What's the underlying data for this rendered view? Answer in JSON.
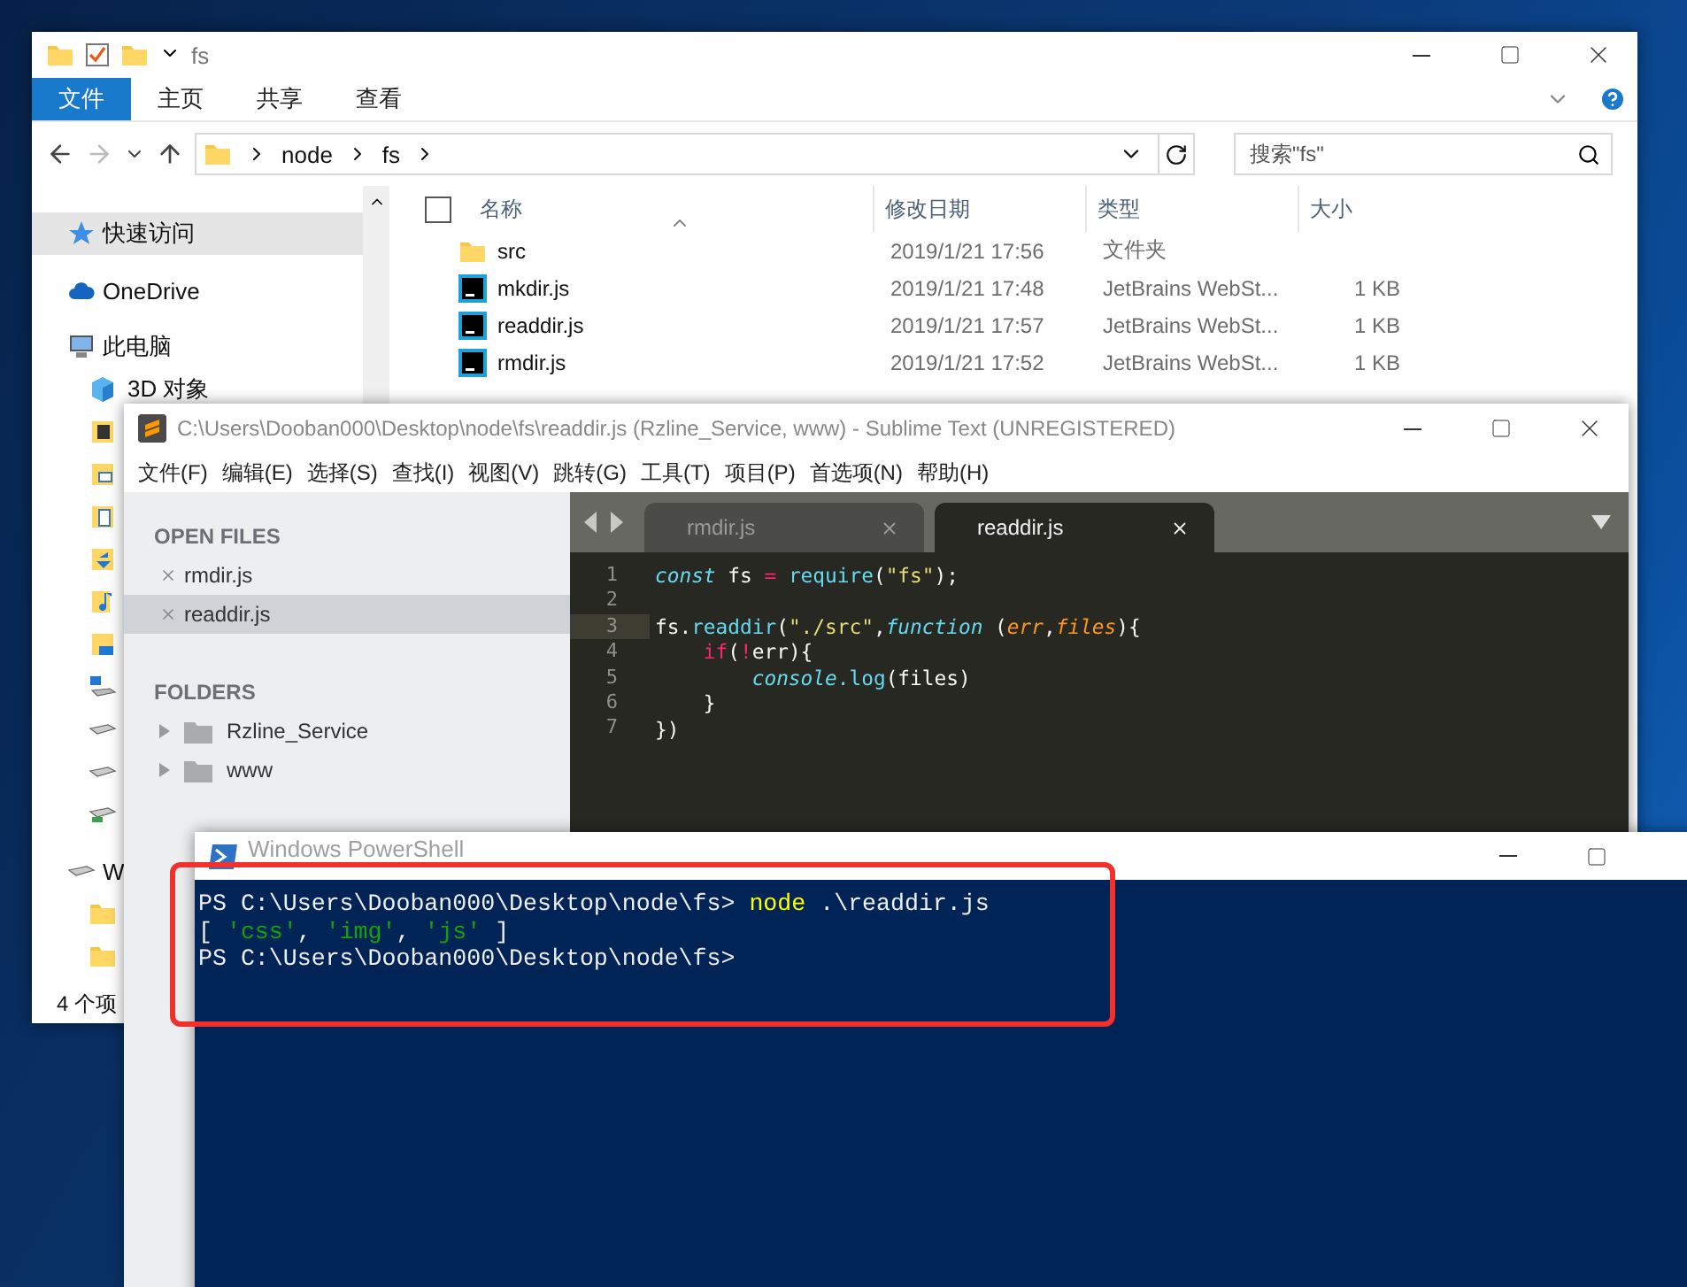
{
  "explorer": {
    "title": "fs",
    "ribbon_tabs": [
      {
        "label": "文件",
        "selected": true
      },
      {
        "label": "主页",
        "selected": false
      },
      {
        "label": "共享",
        "selected": false
      },
      {
        "label": "查看",
        "selected": false
      }
    ],
    "select_all": {
      "checked": false
    },
    "nav": {
      "back": {
        "disabled": false
      },
      "forward": {
        "disabled": true
      }
    },
    "breadcrumbs": [
      "node",
      "fs"
    ],
    "search": {
      "placeholder": "搜索\"fs\""
    },
    "sidebar": [
      {
        "kind": "star",
        "label": "快速访问",
        "selected": true
      },
      {
        "kind": "cloud",
        "label": "OneDrive",
        "selected": false
      },
      {
        "kind": "pc",
        "label": "此电脑",
        "selected": false,
        "children": [
          {
            "kind": "cube",
            "label": "3D 对象",
            "selected": false
          },
          {
            "kind": "film",
            "selected": false
          },
          {
            "kind": "image",
            "selected": false
          },
          {
            "kind": "document",
            "selected": false
          },
          {
            "kind": "download",
            "selected": false
          },
          {
            "kind": "music",
            "selected": false
          },
          {
            "kind": "desktop",
            "selected": false
          },
          {
            "kind": "system-drive",
            "selected": false
          },
          {
            "kind": "drive",
            "selected": false
          },
          {
            "kind": "drive",
            "selected": false
          },
          {
            "kind": "network-drive",
            "selected": false
          }
        ]
      },
      {
        "kind": "drive",
        "label": "W",
        "selected": false,
        "children": [
          {
            "kind": "folder",
            "selected": false
          },
          {
            "kind": "folder",
            "selected": false
          }
        ]
      }
    ],
    "columns": [
      "名称",
      "修改日期",
      "类型",
      "大小"
    ],
    "rows": [
      {
        "kind": "folder",
        "name": "src",
        "modified": "2019/1/21 17:56",
        "type": "文件夹"
      },
      {
        "kind": "script",
        "name": "mkdir.js",
        "modified": "2019/1/21 17:48",
        "type": "JetBrains WebSt...",
        "size": "1 KB"
      },
      {
        "kind": "script",
        "name": "readdir.js",
        "modified": "2019/1/21 17:57",
        "type": "JetBrains WebSt...",
        "size": "1 KB"
      },
      {
        "kind": "script",
        "name": "rmdir.js",
        "modified": "2019/1/21 17:52",
        "type": "JetBrains WebSt...",
        "size": "1 KB"
      }
    ],
    "status": "4 个项"
  },
  "sublime": {
    "title": "C:\\Users\\Dooban000\\Desktop\\node\\fs\\readdir.js (Rzline_Service, www) - Sublime Text (UNREGISTERED)",
    "menu": [
      "文件(F)",
      "编辑(E)",
      "选择(S)",
      "查找(I)",
      "视图(V)",
      "跳转(G)",
      "工具(T)",
      "项目(P)",
      "首选项(N)",
      "帮助(H)"
    ],
    "open_files": {
      "heading": "OPEN FILES",
      "items": [
        {
          "name": "rmdir.js",
          "selected": false
        },
        {
          "name": "readdir.js",
          "selected": true
        }
      ]
    },
    "folders": {
      "heading": "FOLDERS",
      "items": [
        "Rzline_Service",
        "www"
      ]
    },
    "tabs": [
      {
        "label": "rmdir.js",
        "selected": false
      },
      {
        "label": "readdir.js",
        "selected": true
      }
    ],
    "lines": [
      {
        "number": "1",
        "current": false,
        "tokens": [
          {
            "kind": "storage",
            "text": "const"
          },
          {
            "kind": "plain",
            "text": " fs "
          },
          {
            "kind": "keyword",
            "text": "="
          },
          {
            "kind": "support",
            "text": " require"
          },
          {
            "kind": "plain",
            "text": "("
          },
          {
            "kind": "string",
            "text": "\"fs\""
          },
          {
            "kind": "plain",
            "text": ");"
          }
        ]
      },
      {
        "number": "2",
        "current": false
      },
      {
        "number": "3",
        "current": true,
        "tokens": [
          {
            "kind": "plain",
            "text": "fs."
          },
          {
            "kind": "support",
            "text": "readdir"
          },
          {
            "kind": "plain",
            "text": "("
          },
          {
            "kind": "string",
            "text": "\"./src\""
          },
          {
            "kind": "plain",
            "text": ","
          },
          {
            "kind": "storage",
            "text": "function"
          },
          {
            "kind": "plain",
            "text": " ("
          },
          {
            "kind": "param",
            "text": "err"
          },
          {
            "kind": "plain",
            "text": ","
          },
          {
            "kind": "param",
            "text": "files"
          },
          {
            "kind": "plain",
            "text": "){"
          }
        ]
      },
      {
        "number": "4",
        "current": false,
        "tokens": [
          {
            "kind": "keyword",
            "text": "    if"
          },
          {
            "kind": "plain",
            "text": "("
          },
          {
            "kind": "keyword",
            "text": "!"
          },
          {
            "kind": "plain",
            "text": "err){"
          }
        ]
      },
      {
        "number": "5",
        "current": false,
        "tokens": [
          {
            "kind": "storage",
            "text": "        console"
          },
          {
            "kind": "support",
            "text": ".log"
          },
          {
            "kind": "plain",
            "text": "(files)"
          }
        ]
      },
      {
        "number": "6",
        "current": false,
        "tokens": [
          {
            "kind": "plain",
            "text": "    }"
          }
        ]
      },
      {
        "number": "7",
        "current": false,
        "tokens": [
          {
            "kind": "plain",
            "text": "})"
          }
        ]
      }
    ]
  },
  "powershell": {
    "title": "Windows PowerShell",
    "lines": [
      [
        {
          "kind": "plain",
          "text": "PS C:\\Users\\Dooban000\\Desktop\\node\\fs> "
        },
        {
          "kind": "command",
          "text": "node"
        },
        {
          "kind": "plain",
          "text": " .\\readdir.js"
        }
      ],
      [
        {
          "kind": "plain",
          "text": "[ "
        },
        {
          "kind": "string",
          "text": "'css'"
        },
        {
          "kind": "plain",
          "text": ", "
        },
        {
          "kind": "string",
          "text": "'img'"
        },
        {
          "kind": "plain",
          "text": ", "
        },
        {
          "kind": "string",
          "text": "'js'"
        },
        {
          "kind": "plain",
          "text": " ]"
        }
      ],
      [
        {
          "kind": "plain",
          "text": "PS C:\\Users\\Dooban000\\Desktop\\node\\fs>"
        }
      ]
    ]
  }
}
